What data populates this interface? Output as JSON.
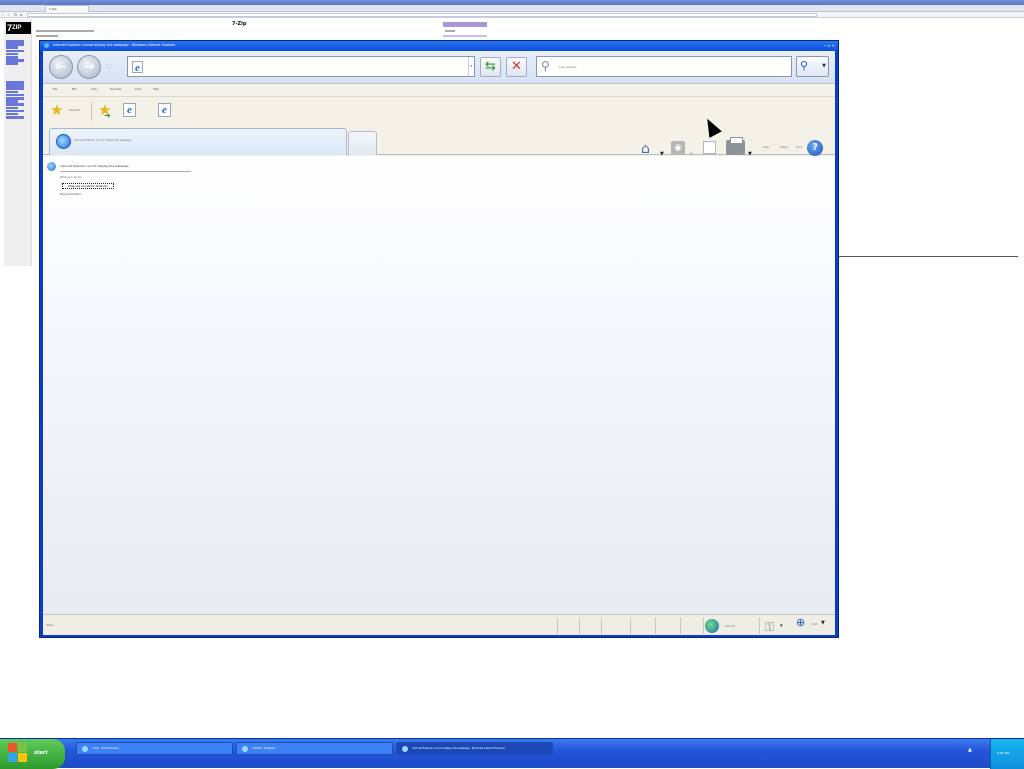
{
  "background_browser": {
    "tab_title": "7-Zip",
    "page_heading": "7-Zip",
    "logo": "7ZIP"
  },
  "ie_window": {
    "title": "Internet Explorer cannot display the webpage - Windows Internet Explorer",
    "address": {
      "value": "",
      "placeholder": ""
    },
    "search": {
      "placeholder": "Live Search"
    },
    "menu": [
      "File",
      "Edit",
      "View",
      "Favorites",
      "Tools",
      "Help"
    ],
    "favorites_bar": {
      "label": "Favorites"
    },
    "tab": {
      "label": "Internet Explorer cannot display the webpage"
    },
    "command_bar": {
      "page_label": "Page",
      "tools_label": "Tools",
      "safety_label": "Safety"
    },
    "content": {
      "heading": "Internet Explorer cannot display the webpage",
      "subheading": "What you can try:",
      "diagnose_button": "Diagnose Connection Problems",
      "more_info": "More information"
    },
    "status_bar": {
      "status_text": "Done",
      "zone": "Internet",
      "zoom": "100%"
    }
  },
  "taskbar": {
    "start_label": "start",
    "tasks": [
      {
        "label": "7-Zip - Mozilla Firefox",
        "active": false
      },
      {
        "label": "Untitled - Notepad",
        "active": false
      },
      {
        "label": "Internet Explorer cannot display the webpage - Windows Internet Explorer",
        "active": true
      }
    ],
    "clock": "8:06 PM"
  },
  "colors": {
    "xp_blue": "#2555d8",
    "start_green": "#2e9a2c",
    "ie_title": "#0b4fd8",
    "refresh_green": "#2d9b27",
    "stop_red": "#d23a2b"
  }
}
